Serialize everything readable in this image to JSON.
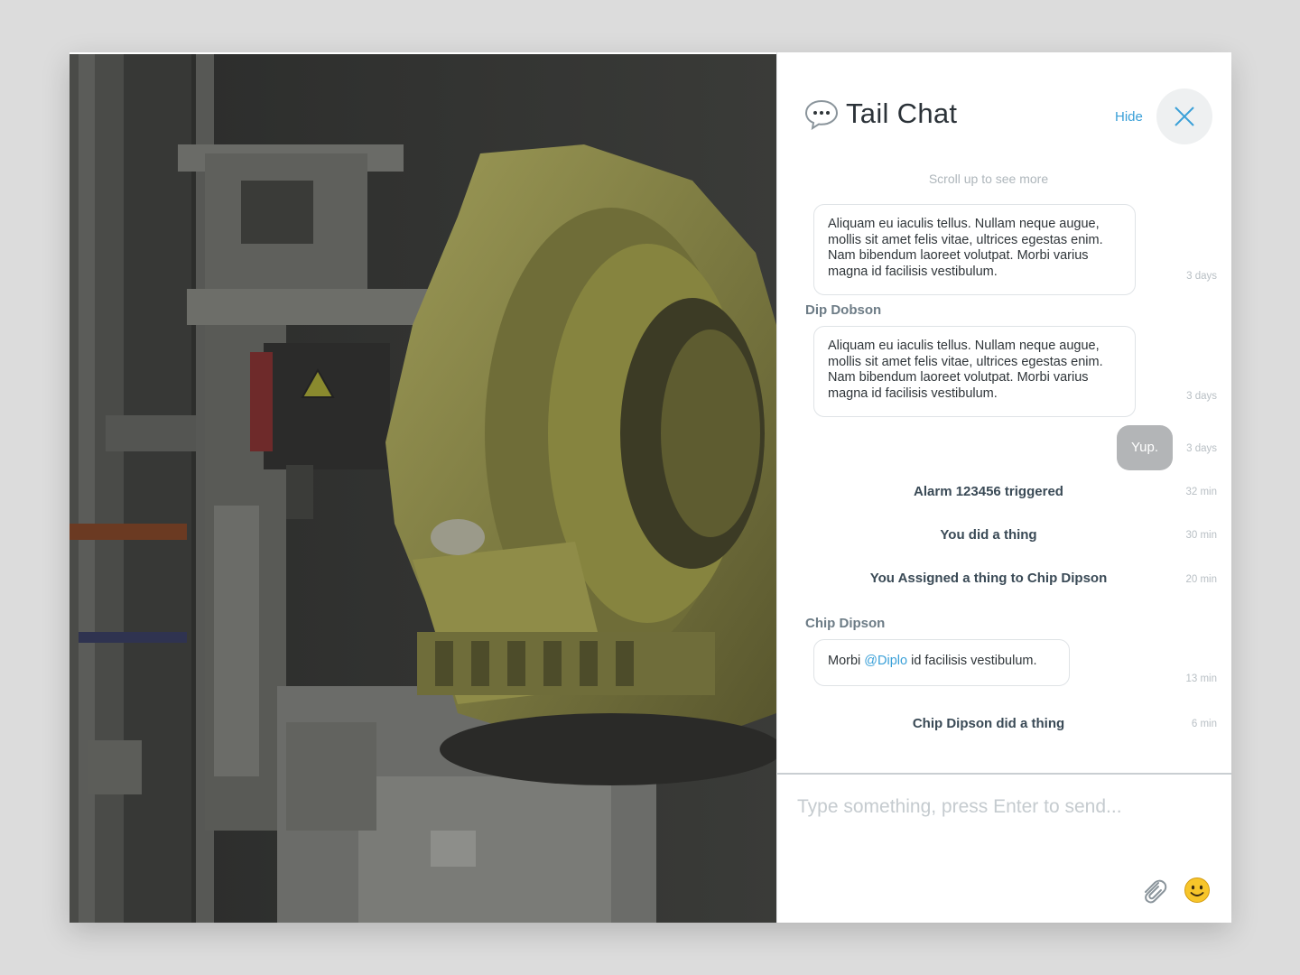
{
  "chat": {
    "title": "Tail Chat",
    "hide_label": "Hide",
    "scroll_hint": "Scroll up to see more",
    "messages": [
      {
        "kind": "bubble",
        "text": "Aliquam eu iaculis tellus. Nullam neque augue, mollis sit amet felis vitae, ultrices egestas enim. Nam bibendum laoreet volutpat. Morbi varius magna id facilisis vestibulum.",
        "time": "3 days"
      },
      {
        "kind": "bubble",
        "sender": "Dip Dobson",
        "text": "Aliquam eu iaculis tellus. Nullam neque augue, mollis sit amet felis vitae, ultrices egestas enim. Nam bibendum laoreet volutpat. Morbi varius magna id facilisis vestibulum.",
        "time": "3 days"
      },
      {
        "kind": "mine",
        "text": "Yup.",
        "time": "3 days"
      },
      {
        "kind": "event",
        "text": "Alarm 123456 triggered",
        "time": "32 min"
      },
      {
        "kind": "event",
        "text": "You did a thing",
        "time": "30 min"
      },
      {
        "kind": "event",
        "text": "You Assigned a thing to Chip Dipson",
        "time": "20 min"
      },
      {
        "kind": "bubble",
        "sender": "Chip Dipson",
        "text_before": "Morbi ",
        "mention": "@Diplo",
        "text_after": " id facilisis vestibulum.",
        "time": "13 min"
      },
      {
        "kind": "event",
        "text": "Chip Dipson did a thing",
        "time": "6 min"
      }
    ],
    "composer": {
      "placeholder": "Type something, press Enter to send...",
      "value": ""
    }
  },
  "icons": {
    "chat": "speech-bubble-icon",
    "close": "close-icon",
    "attach": "paperclip-icon",
    "emoji": "smiley-icon"
  },
  "colors": {
    "accent": "#3aa0d8",
    "sender": "#6d7c86",
    "event": "#3a4a56",
    "own_bubble": "#b3b5b7"
  }
}
